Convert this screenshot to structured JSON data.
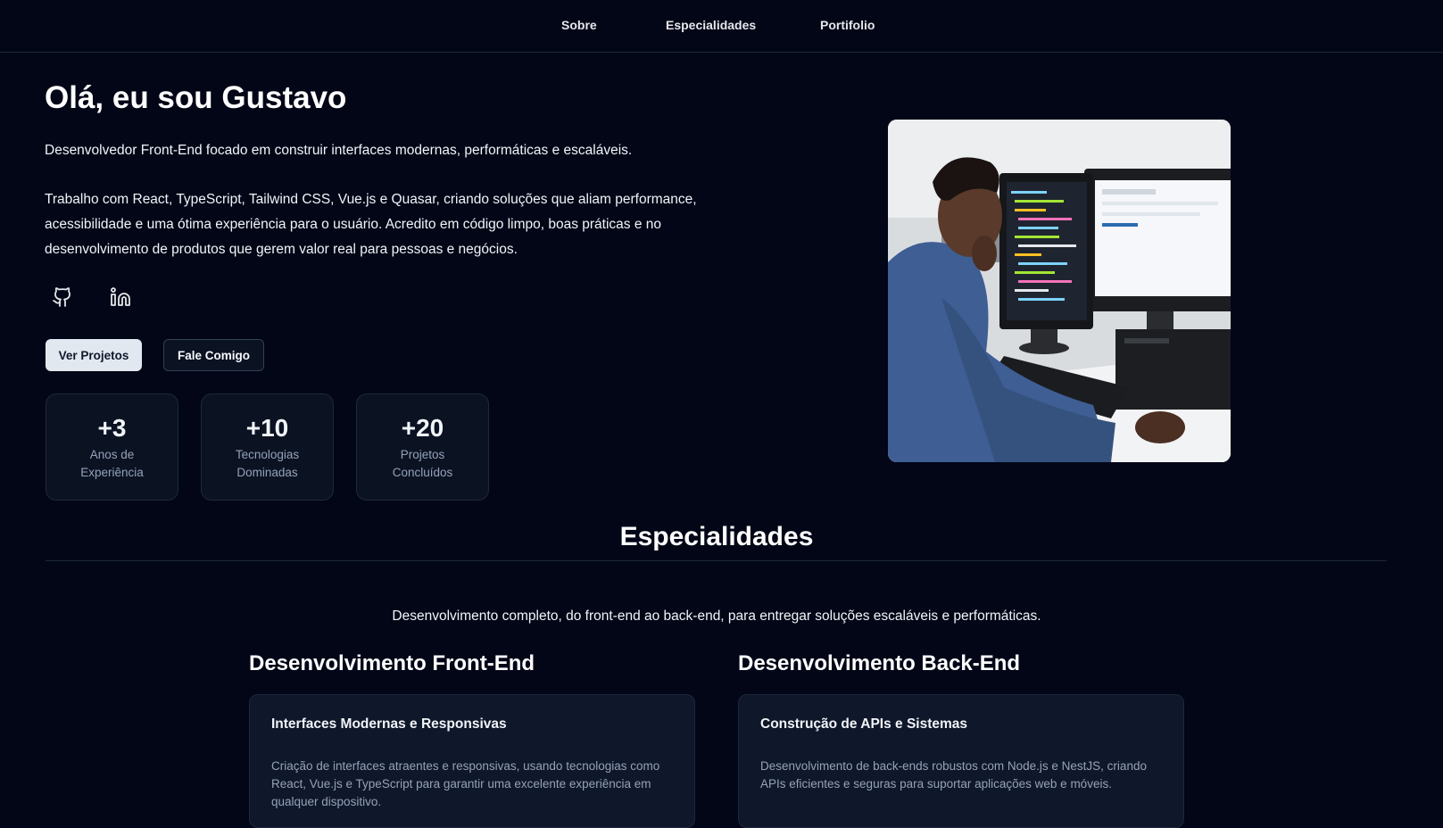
{
  "nav": {
    "items": [
      {
        "label": "Sobre"
      },
      {
        "label": "Especialidades"
      },
      {
        "label": "Portifolio"
      }
    ]
  },
  "hero": {
    "title": "Olá, eu sou Gustavo",
    "lead": "Desenvolvedor Front-End focado em construir interfaces modernas, performáticas e escaláveis.",
    "body": "Trabalho com React, TypeScript, Tailwind CSS, Vue.js e Quasar, criando soluções que aliam performance, acessibilidade e uma ótima experiência para o usuário. Acredito em código limpo, boas práticas e no desenvolvimento de produtos que gerem valor real para pessoas e negócios.",
    "social": [
      {
        "icon": "github-icon"
      },
      {
        "icon": "linkedin-icon"
      }
    ],
    "buttons": {
      "primary": "Ver Projetos",
      "secondary": "Fale Comigo"
    },
    "stats": [
      {
        "value": "+3",
        "label_line1": "Anos de",
        "label_line2": "Experiência"
      },
      {
        "value": "+10",
        "label_line1": "Tecnologias",
        "label_line2": "Dominadas"
      },
      {
        "value": "+20",
        "label_line1": "Projetos",
        "label_line2": "Concluídos"
      }
    ]
  },
  "specialties": {
    "title": "Especialidades",
    "subtitle": "Desenvolvimento completo, do front-end ao back-end, para entregar soluções escaláveis e performáticas.",
    "columns": [
      {
        "title": "Desenvolvimento Front-End",
        "card_title": "Interfaces Modernas e Responsivas",
        "card_desc": "Criação de interfaces atraentes e responsivas, usando tecnologias como React, Vue.js e TypeScript para garantir uma excelente experiência em qualquer dispositivo."
      },
      {
        "title": "Desenvolvimento Back-End",
        "card_title": "Construção de APIs e Sistemas",
        "card_desc": "Desenvolvimento de back-ends robustos com Node.js e NestJS, criando APIs eficientes e seguras para suportar aplicações web e móveis."
      }
    ]
  },
  "colors": {
    "background": "#020617",
    "card": "#0b1222",
    "border": "#1e293b",
    "muted_text": "#94a3b8",
    "primary_button": "#e2e8f0"
  }
}
